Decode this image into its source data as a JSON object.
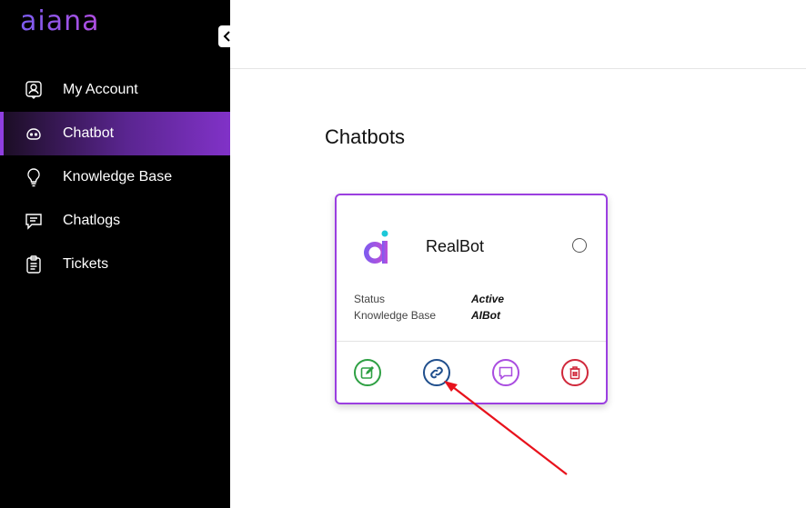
{
  "app": {
    "logo_text": "aiana"
  },
  "sidebar": {
    "items": [
      {
        "label": "My Account",
        "icon": "user-badge-icon",
        "active": false
      },
      {
        "label": "Chatbot",
        "icon": "bot-face-icon",
        "active": true
      },
      {
        "label": "Knowledge Base",
        "icon": "lightbulb-icon",
        "active": false
      },
      {
        "label": "Chatlogs",
        "icon": "chat-bubble-icon",
        "active": false
      },
      {
        "label": "Tickets",
        "icon": "clipboard-icon",
        "active": false
      }
    ]
  },
  "main": {
    "title": "Chatbots",
    "cards": [
      {
        "name": "RealBot",
        "status_label": "Status",
        "status_value": "Active",
        "kb_label": "Knowledge Base",
        "kb_value": "AIBot",
        "actions": [
          "edit-icon",
          "link-icon",
          "chat-icon",
          "trash-icon"
        ]
      }
    ]
  },
  "colors": {
    "accent": "#8f3fe0",
    "edit": "#2ea043",
    "link": "#1f4e8c",
    "chat": "#a94ce0",
    "delete": "#d0283b",
    "annotation_arrow": "#e8121c"
  }
}
